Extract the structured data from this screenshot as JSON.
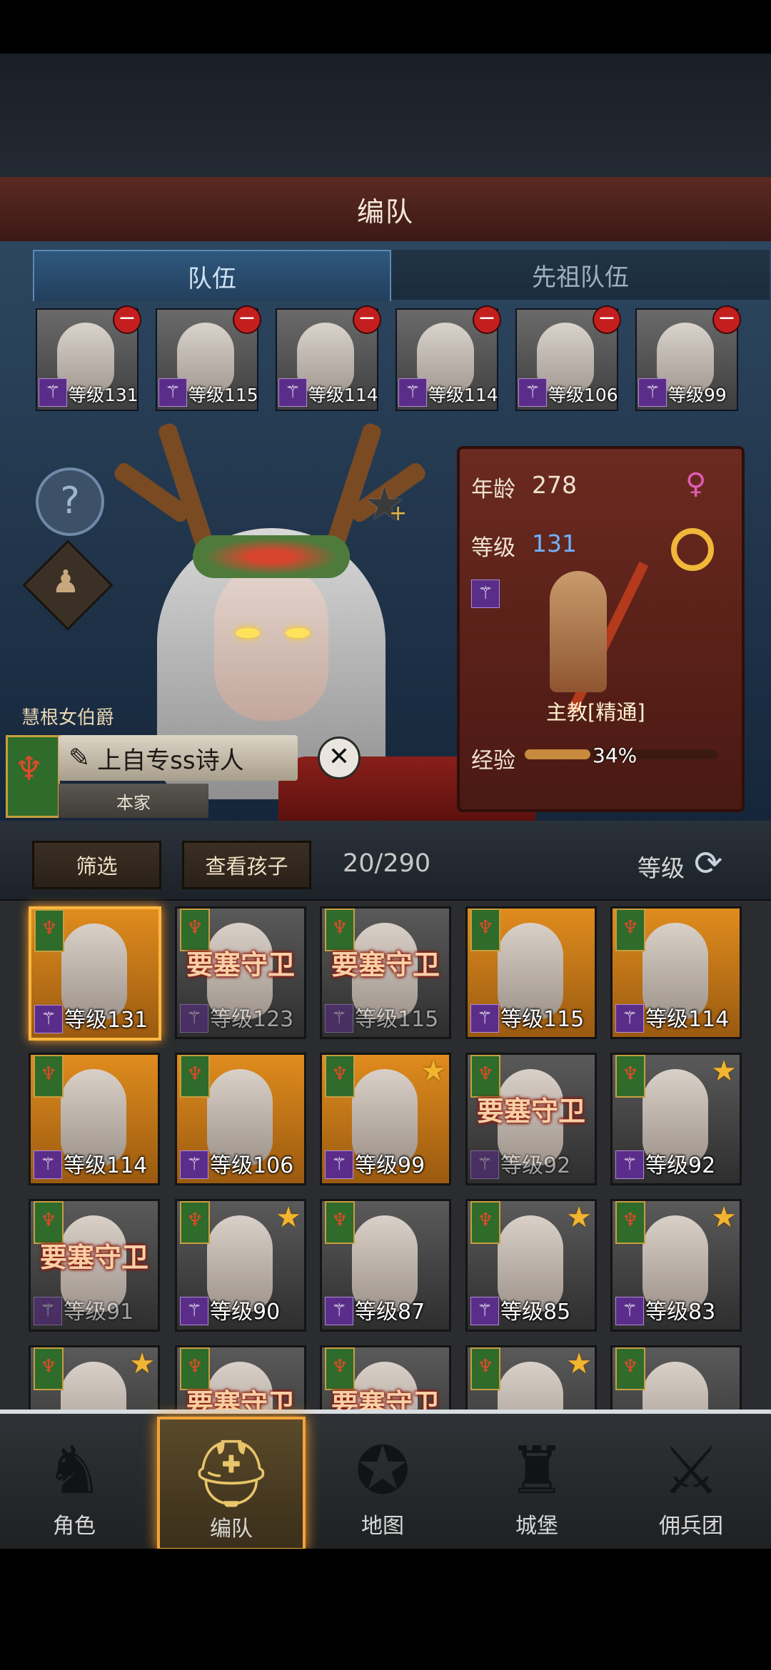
{
  "header": {
    "title": "编队"
  },
  "tabs": [
    {
      "label": "队伍",
      "active": true
    },
    {
      "label": "先祖队伍",
      "active": false
    }
  ],
  "team": [
    {
      "level": "等级131"
    },
    {
      "level": "等级115"
    },
    {
      "level": "等级114"
    },
    {
      "level": "等级114"
    },
    {
      "level": "等级106"
    },
    {
      "level": "等级99"
    }
  ],
  "hero": {
    "title": "慧根女伯爵",
    "name": "上自专ss诗人",
    "house": "本家"
  },
  "info": {
    "age_label": "年龄",
    "age_value": "278",
    "level_label": "等级",
    "level_value": "131",
    "class_name": "主教[精通]",
    "exp_label": "经验",
    "exp_percent": "34%",
    "exp_fraction": 0.34,
    "gender_icon": "female-icon",
    "level_color": "#6fb3ff"
  },
  "toolbar": {
    "filter_label": "筛选",
    "children_label": "查看孩子",
    "count": "20/290",
    "sort_label": "等级"
  },
  "roster": [
    {
      "level": "等级131",
      "guard": "",
      "star": false,
      "bg": "gold",
      "selected": true
    },
    {
      "level": "等级123",
      "guard": "要塞守卫",
      "star": false,
      "bg": "grey",
      "dim": true
    },
    {
      "level": "等级115",
      "guard": "要塞守卫",
      "star": false,
      "bg": "grey",
      "dim": true
    },
    {
      "level": "等级115",
      "guard": "",
      "star": false,
      "bg": "gold"
    },
    {
      "level": "等级114",
      "guard": "",
      "star": false,
      "bg": "gold"
    },
    {
      "level": "等级114",
      "guard": "",
      "star": false,
      "bg": "gold"
    },
    {
      "level": "等级106",
      "guard": "",
      "star": false,
      "bg": "gold"
    },
    {
      "level": "等级99",
      "guard": "",
      "star": true,
      "bg": "gold"
    },
    {
      "level": "等级92",
      "guard": "要塞守卫",
      "star": false,
      "bg": "grey",
      "dim": true
    },
    {
      "level": "等级92",
      "guard": "",
      "star": true,
      "bg": "grey"
    },
    {
      "level": "等级91",
      "guard": "要塞守卫",
      "star": false,
      "bg": "grey",
      "dim": true
    },
    {
      "level": "等级90",
      "guard": "",
      "star": true,
      "bg": "grey"
    },
    {
      "level": "等级87",
      "guard": "",
      "star": false,
      "bg": "grey"
    },
    {
      "level": "等级85",
      "guard": "",
      "star": true,
      "bg": "grey"
    },
    {
      "level": "等级83",
      "guard": "",
      "star": true,
      "bg": "grey"
    },
    {
      "level": "",
      "guard": "",
      "star": true,
      "bg": "grey"
    },
    {
      "level": "",
      "guard": "要塞守卫",
      "star": false,
      "bg": "grey",
      "dim": true
    },
    {
      "level": "",
      "guard": "要塞守卫",
      "star": false,
      "bg": "grey",
      "dim": true
    },
    {
      "level": "",
      "guard": "",
      "star": true,
      "bg": "grey"
    },
    {
      "level": "",
      "guard": "",
      "star": false,
      "bg": "grey"
    }
  ],
  "nav": [
    {
      "label": "角色",
      "icon": "knight-icon",
      "active": false
    },
    {
      "label": "编队",
      "icon": "helmet-icon",
      "active": true
    },
    {
      "label": "地图",
      "icon": "compass-map-icon",
      "active": false
    },
    {
      "label": "城堡",
      "icon": "castle-icon",
      "active": false
    },
    {
      "label": "佣兵团",
      "icon": "mercenary-icon",
      "active": false
    }
  ]
}
